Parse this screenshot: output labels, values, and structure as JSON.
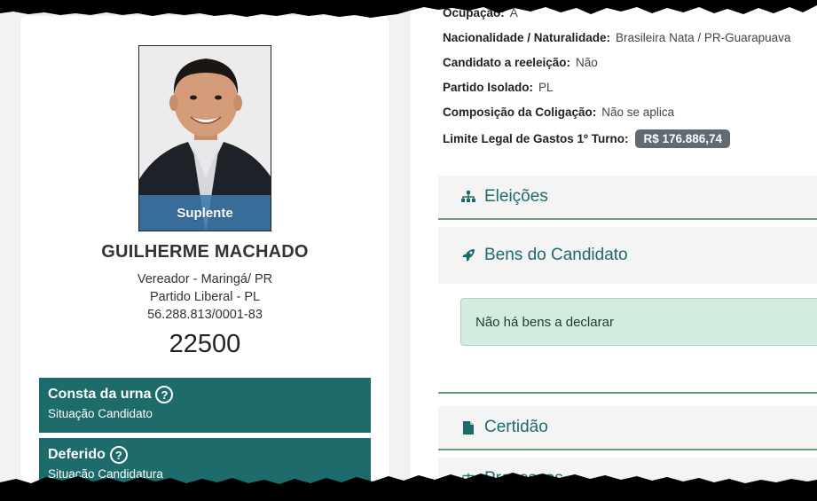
{
  "candidate": {
    "status_badge": "Suplente",
    "name": "GUILHERME MACHADO",
    "office": "Vereador - Maringá/ PR",
    "party": "Partido Liberal - PL",
    "cnpj": "56.288.813/0001-83",
    "number": "22500"
  },
  "status_boxes": [
    {
      "title": "Consta da urna",
      "subtitle": "Situação Candidato"
    },
    {
      "title": "Deferido",
      "subtitle": "Situação Candidatura"
    }
  ],
  "details": {
    "occupation_label": "Ocupação:",
    "occupation_value": "A",
    "nationality_label": "Nacionalidade / Naturalidade:",
    "nationality_value": "Brasileira Nata / PR-Guarapuava",
    "reelection_label": "Candidato a reeleição:",
    "reelection_value": "Não",
    "party_label": "Partido Isolado:",
    "party_value": "PL",
    "coalition_label": "Composição da Coligação:",
    "coalition_value": "Não se aplica",
    "spending_label": "Limite Legal de Gastos 1º Turno:",
    "spending_value": "R$ 176.886,74"
  },
  "sections": {
    "elections": "Eleições",
    "assets": "Bens do Candidato",
    "assets_message": "Não há bens a declarar",
    "certificate": "Certidão",
    "processes": "Processos"
  },
  "colors": {
    "primary": "#1e6b6b",
    "badge": "#606a72",
    "alert_bg": "#d4ecdf"
  }
}
